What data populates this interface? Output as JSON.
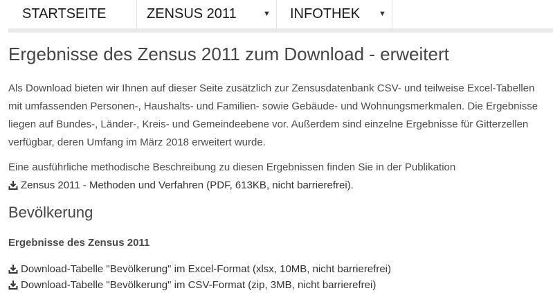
{
  "nav": {
    "items": [
      {
        "label": "STARTSEITE"
      },
      {
        "label": "ZENSUS 2011",
        "has_dropdown": true
      },
      {
        "label": "INFOTHEK",
        "has_dropdown": true
      }
    ]
  },
  "page": {
    "title": "Ergebnisse des Zensus 2011 zum Download - erweitert",
    "intro": "Als Download bieten wir Ihnen auf dieser Seite zusätzlich zur Zensusdatenbank CSV- und teilweise Excel-Tabellen mit umfassenden Personen-, Haushalts- und Familien- sowie Gebäude- und Wohnungsmerkmalen. Die Ergebnisse liegen auf Bundes-, Länder-, Kreis- und Gemeindeebene vor. Außerdem sind einzelne Ergebnisse für Gitterzellen verfügbar, deren Umfang im März 2018 erweitert wurde.",
    "method_text": "Eine ausführliche methodische Beschreibung zu diesen Ergebnissen finden Sie in der Publikation",
    "method_link": "Zensus 2011 - Methoden und Verfahren (PDF, 613KB, nicht barrierefrei)."
  },
  "section": {
    "heading": "Bevölkerung",
    "subheading": "Ergebnisse des Zensus 2011",
    "downloads": [
      {
        "label": "Download-Tabelle \"Bevölkerung\" im Excel-Format (xlsx, 10MB, nicht barrierefrei)"
      },
      {
        "label": "Download-Tabelle \"Bevölkerung\" im CSV-Format (zip, 3MB, nicht barrierefrei)"
      }
    ]
  },
  "icons": {
    "download": "download-icon",
    "dropdown": "chevron-down-icon"
  },
  "colors": {
    "text": "#474747",
    "nav_border": "#e9e9e9"
  }
}
